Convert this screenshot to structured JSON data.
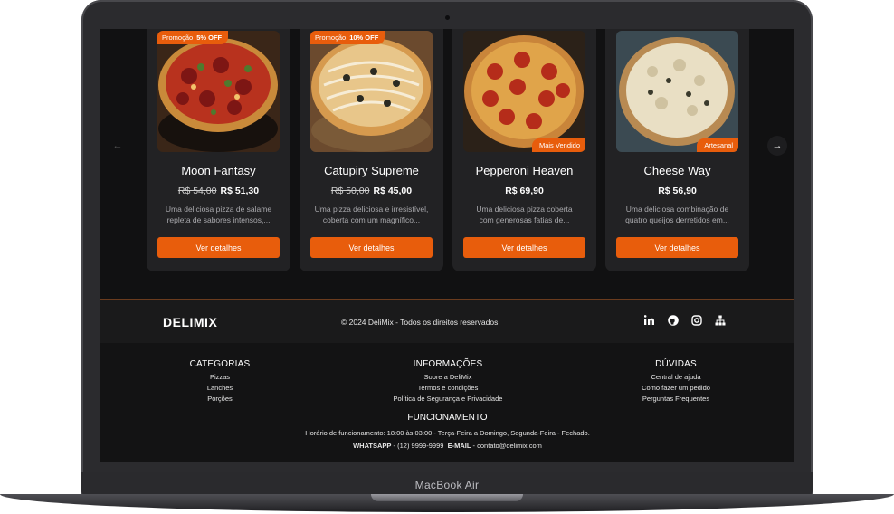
{
  "device": {
    "label": "MacBook Air"
  },
  "carousel": {
    "prev_icon": "arrow-left-icon",
    "next_icon": "arrow-right-icon",
    "cards": [
      {
        "badge_label": "Promoção",
        "badge_value": "5% OFF",
        "corner_badge": "",
        "title": "Moon Fantasy",
        "old_price": "R$ 54,00",
        "price": "R$ 51,30",
        "desc_line1": "Uma deliciosa pizza de salame",
        "desc_line2": "repleta de sabores intensos,...",
        "button": "Ver detalhes"
      },
      {
        "badge_label": "Promoção",
        "badge_value": "10% OFF",
        "corner_badge": "",
        "title": "Catupiry Supreme",
        "old_price": "R$ 50,00",
        "price": "R$ 45,00",
        "desc_line1": "Uma pizza deliciosa e irresistível,",
        "desc_line2": "coberta com um magnífico...",
        "button": "Ver detalhes"
      },
      {
        "badge_label": "",
        "badge_value": "",
        "corner_badge": "Mais Vendido",
        "title": "Pepperoni Heaven",
        "old_price": "",
        "price": "R$ 69,90",
        "desc_line1": "Uma deliciosa pizza coberta",
        "desc_line2": "com generosas fatias de...",
        "button": "Ver detalhes"
      },
      {
        "badge_label": "",
        "badge_value": "",
        "corner_badge": "Artesanal",
        "title": "Cheese Way",
        "old_price": "",
        "price": "R$ 56,90",
        "desc_line1": "Uma deliciosa combinação de",
        "desc_line2": "quatro queijos derretidos em...",
        "button": "Ver detalhes"
      }
    ]
  },
  "footer": {
    "logo": "DELIMIX",
    "copyright": "© 2024 DeliMix - Todos os direitos reservados.",
    "socials": [
      "linkedin-icon",
      "github-icon",
      "instagram-icon",
      "sitemap-icon"
    ],
    "columns": [
      {
        "title": "CATEGORIAS",
        "links": [
          "Pizzas",
          "Lanches",
          "Porções"
        ]
      },
      {
        "title": "INFORMAÇÕES",
        "links": [
          "Sobre a DeliMix",
          "Termos e condições",
          "Política de Segurança e Privacidade"
        ]
      },
      {
        "title": "DÚVIDAS",
        "links": [
          "Central de ajuda",
          "Como fazer um pedido",
          "Perguntas Frequentes"
        ]
      }
    ],
    "hours_title": "FUNCIONAMENTO",
    "hours_text": "Horário de funcionamento: 18:00 às 03:00 - Terça-Feira a Domingo, Segunda-Feira - Fechado.",
    "whatsapp_label": "WHATSAPP",
    "whatsapp_value": "(12) 9999-9999",
    "email_label": "E-MAIL",
    "email_value": "contato@delimix.com"
  },
  "colors": {
    "accent": "#e85d0c",
    "card": "#222224",
    "background": "#111112"
  }
}
